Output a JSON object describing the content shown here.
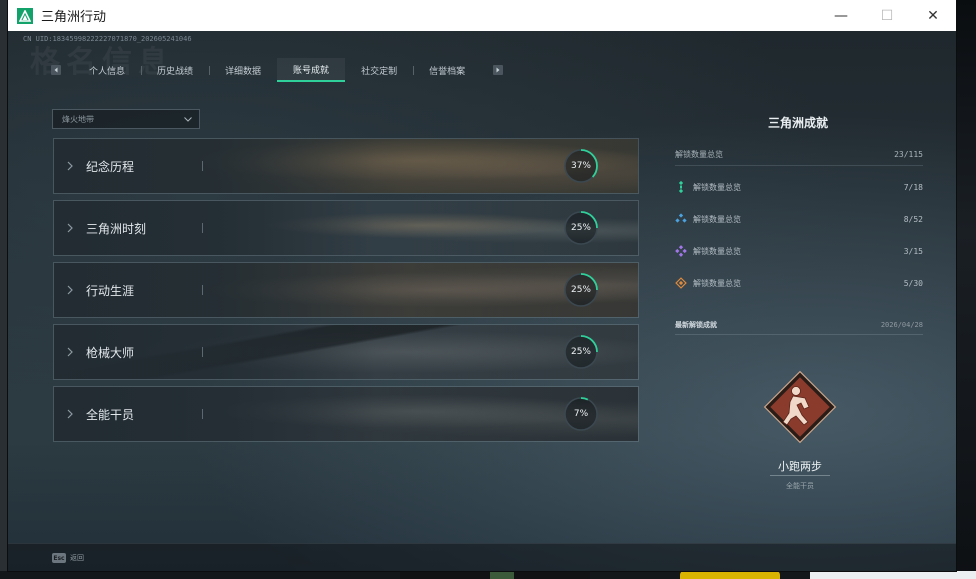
{
  "window": {
    "title": "三角洲行动",
    "controls": {
      "minimize": "—",
      "maximize": "☐",
      "close": "✕"
    }
  },
  "header": {
    "uid": "CN UID:18345998222227071870_202605241046",
    "watermark": "格名信息"
  },
  "tabs": [
    {
      "label": "个人信息",
      "active": false
    },
    {
      "label": "历史战绩",
      "active": false
    },
    {
      "label": "详细数据",
      "active": false
    },
    {
      "label": "账号成就",
      "active": true
    },
    {
      "label": "社交定制",
      "active": false
    },
    {
      "label": "信誉档案",
      "active": false
    }
  ],
  "filter": {
    "label": "烽火地带"
  },
  "categories": [
    {
      "name": "纪念历程",
      "progress": 37,
      "progress_label": "37%",
      "icon": "chevron-right-icon"
    },
    {
      "name": "三角洲时刻",
      "progress": 25,
      "progress_label": "25%",
      "icon": "chevron-right-icon"
    },
    {
      "name": "行动生涯",
      "progress": 25,
      "progress_label": "25%",
      "icon": "chevron-right-icon"
    },
    {
      "name": "枪械大师",
      "progress": 25,
      "progress_label": "25%",
      "icon": "chevron-right-icon"
    },
    {
      "name": "全能干员",
      "progress": 7,
      "progress_label": "7%",
      "icon": "chevron-right-icon"
    }
  ],
  "panel": {
    "title": "三角洲成就",
    "summary": {
      "label": "解锁数量总览",
      "value": "23/115"
    },
    "stats": [
      {
        "label": "解锁数量总览",
        "value": "7/18",
        "icon": "green-gem-icon",
        "color": "#2fd09a"
      },
      {
        "label": "解锁数量总览",
        "value": "8/52",
        "icon": "blue-gem-icon",
        "color": "#4aa3e0"
      },
      {
        "label": "解锁数量总览",
        "value": "3/15",
        "icon": "purple-gem-icon",
        "color": "#a276e8"
      },
      {
        "label": "解锁数量总览",
        "value": "5/30",
        "icon": "orange-gem-icon",
        "color": "#e08a3c"
      }
    ],
    "latest": {
      "label": "最新解锁成就",
      "date": "2026/04/28"
    },
    "badge": {
      "name": "小跑两步",
      "category": "全能干员",
      "icon": "running-figure-badge-icon"
    }
  },
  "footer": {
    "key": "Esc",
    "label": "返回"
  },
  "colors": {
    "accent": "#2fd09a",
    "ring_track": "#3b4850",
    "badge": "#8a3b2c"
  }
}
